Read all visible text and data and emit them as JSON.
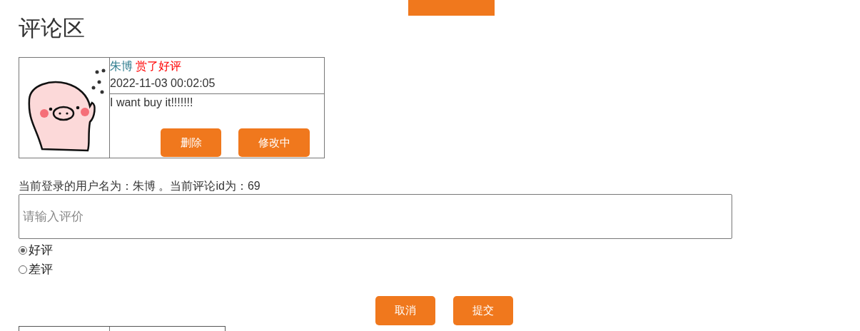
{
  "title": "评论区",
  "comments": [
    {
      "user": "朱博",
      "action": "赏了好评",
      "time": "2022-11-03 00:02:05",
      "content": "I want buy it!!!!!!!",
      "buttons": [
        "删除",
        "修改中"
      ]
    }
  ],
  "status_line": "当前登录的用户名为：朱博 。当前评论id为：69",
  "review_field": {
    "placeholder": "请输入评价"
  },
  "ratings": [
    {
      "label": "好评",
      "selected": true
    },
    {
      "label": "差评",
      "selected": false
    }
  ],
  "form_buttons": [
    "取消",
    "提交"
  ]
}
